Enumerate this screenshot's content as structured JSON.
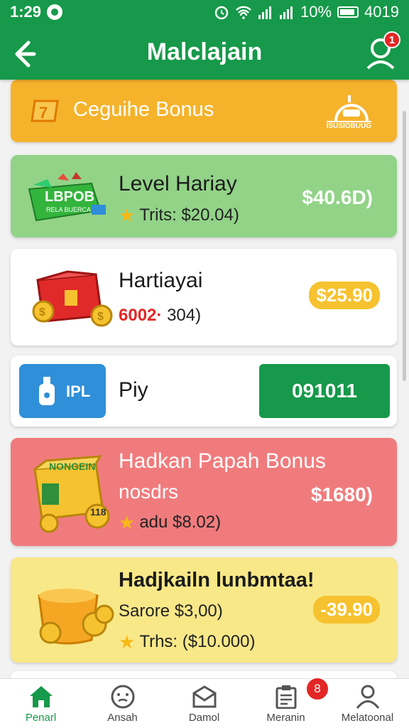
{
  "status_bar": {
    "time": "1:29",
    "right_text": "10%",
    "right_extra": "4019"
  },
  "header": {
    "title": "Malclajain",
    "notification_count": "1"
  },
  "cards": {
    "bonus": {
      "name": "Ceguihe Bonus",
      "badge_icon": "ticket-icon",
      "right_icon": "reward-box-icon",
      "right_label": "ISUSIOBUUG"
    },
    "level": {
      "name": "Level Hariay",
      "sub": "Trits:  $20.04)",
      "amount": "$40.6D)",
      "box_label": "LBPOB",
      "box_sublabel": "RELA BUERCA"
    },
    "hartiay": {
      "name": "Hartiayai",
      "sub_red": "6002·",
      "sub_rest": "304)",
      "amount": "$25.90"
    },
    "piy": {
      "tile_label": "IPL",
      "name": "Piy",
      "button": "091011"
    },
    "papah": {
      "name": "Hadkan Papah Bonus",
      "sub1": "nosdrs",
      "sub2": "adu  $8.02)",
      "amount": "$1680)",
      "box_label": "NONGEIN",
      "box_number": "118"
    },
    "hadikain": {
      "name": "Hadjkailn lunbmtaa!",
      "sub1": "Sarore  $3,00)",
      "sub2": "Trhs: ($10.000)",
      "amount": "-39.90"
    }
  },
  "bottom_nav": {
    "items": [
      {
        "label": "Penarl",
        "icon": "home-icon"
      },
      {
        "label": "Ansah",
        "icon": "support-icon"
      },
      {
        "label": "Damol",
        "icon": "mail-icon"
      },
      {
        "label": "Meranin",
        "icon": "clipboard-icon"
      },
      {
        "label": "Melatoonal",
        "icon": "user-icon"
      }
    ],
    "badge": "8"
  },
  "colors": {
    "primary": "#16994a",
    "orange": "#f5b32c",
    "green_card": "#92d388",
    "red_card": "#f07b7d",
    "yellow_card": "#f8e888",
    "badge": "#e32626",
    "blue": "#2f8fd8"
  }
}
